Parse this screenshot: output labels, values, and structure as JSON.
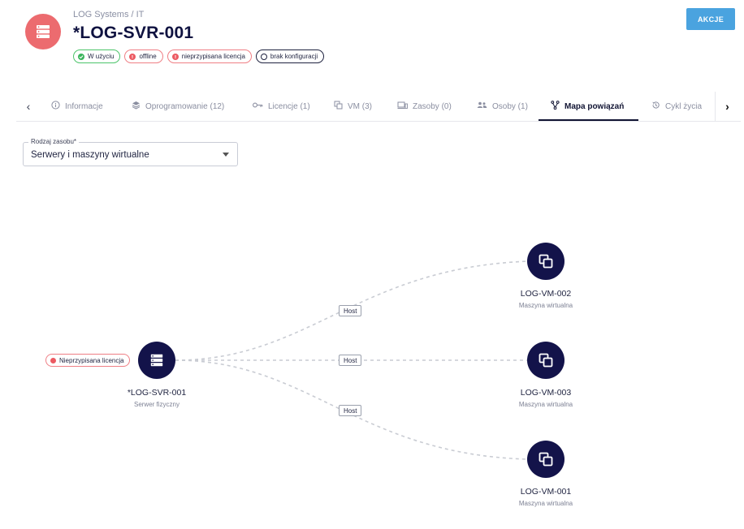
{
  "header": {
    "icon": "server-icon",
    "breadcrumb": "LOG Systems / IT",
    "title": "*LOG-SVR-001",
    "badges": [
      {
        "label": "W użyciu",
        "status": "green"
      },
      {
        "label": "offline",
        "status": "red"
      },
      {
        "label": "nieprzypisana licencja",
        "status": "red"
      },
      {
        "label": "brak konfiguracji",
        "status": "navy"
      }
    ],
    "actions_label": "AKCJE"
  },
  "tabs": [
    {
      "label": "Informacje",
      "icon": "info-icon"
    },
    {
      "label": "Oprogramowanie (12)",
      "icon": "layers-icon"
    },
    {
      "label": "Licencje (1)",
      "icon": "key-icon"
    },
    {
      "label": "VM (3)",
      "icon": "vm-icon"
    },
    {
      "label": "Zasoby (0)",
      "icon": "devices-icon"
    },
    {
      "label": "Osoby (1)",
      "icon": "people-icon"
    },
    {
      "label": "Mapa powiązań",
      "icon": "relations-icon",
      "active": true
    },
    {
      "label": "Cykl życia",
      "icon": "history-icon"
    }
  ],
  "filter": {
    "label": "Rodzaj zasobu*",
    "value": "Serwery i maszyny wirtualne"
  },
  "graph": {
    "source": {
      "name": "*LOG-SVR-001",
      "type": "Serwer fizyczny",
      "warning": "Nieprzypisana licencja"
    },
    "targets": [
      {
        "name": "LOG-VM-002",
        "type": "Maszyna wirtualna",
        "edge_label": "Host"
      },
      {
        "name": "LOG-VM-003",
        "type": "Maszyna wirtualna",
        "edge_label": "Host"
      },
      {
        "name": "LOG-VM-001",
        "type": "Maszyna wirtualna",
        "edge_label": "Host"
      }
    ]
  },
  "colors": {
    "accent": "#4aa3df",
    "node": "#13134a",
    "header_icon_bg": "#ec6b6f",
    "status_green": "#3bb55c",
    "status_red": "#ec5a62"
  }
}
